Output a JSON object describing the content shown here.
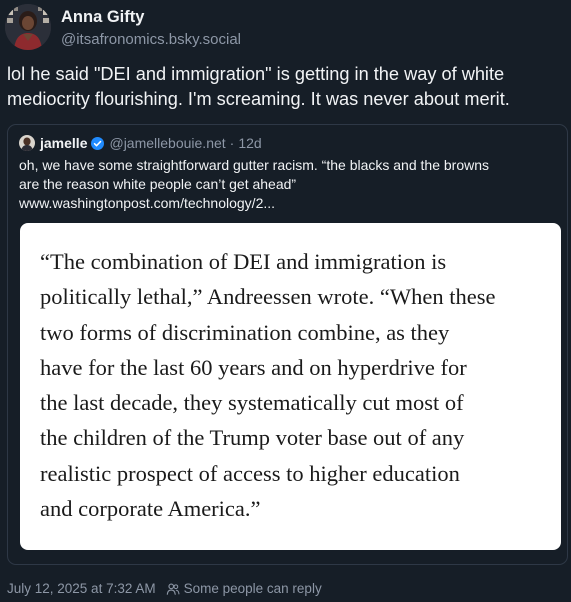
{
  "author": {
    "display_name": "Anna Gifty",
    "handle": "@itsafronomics.bsky.social"
  },
  "post": {
    "text": "lol he said \"DEI and immigration\" is getting in the way of white mediocrity flourishing. I'm screaming. It was never about merit."
  },
  "quoted_post": {
    "display_name": "jamelle",
    "verified": true,
    "handle": "@jamellebouie.net",
    "separator": "·",
    "age": "12d",
    "text_lines": [
      "oh, we have some straightforward gutter racism. “the blacks and the browns",
      "are the reason white people can’t get ahead”",
      "www.washingtonpost.com/technology/2..."
    ],
    "image_text_lines": [
      "“The combination of DEI and immigration is",
      "politically lethal,” Andreessen wrote. “When these",
      "two forms of discrimination combine, as they",
      "have for the last 60 years and on hyperdrive for",
      "the last decade, they systematically cut most of",
      "the children of the Trump voter base out of any",
      "realistic prospect of access to higher education",
      "and corporate America.”"
    ]
  },
  "footer": {
    "timestamp": "July 12, 2025 at 7:32 AM",
    "reply_setting": "Some people can reply",
    "icon": "people-icon"
  },
  "colors": {
    "background": "#161e27",
    "text": "#f1f3f5",
    "muted": "#8d97a6",
    "verified": "#208bfe",
    "border": "#2e3846"
  }
}
